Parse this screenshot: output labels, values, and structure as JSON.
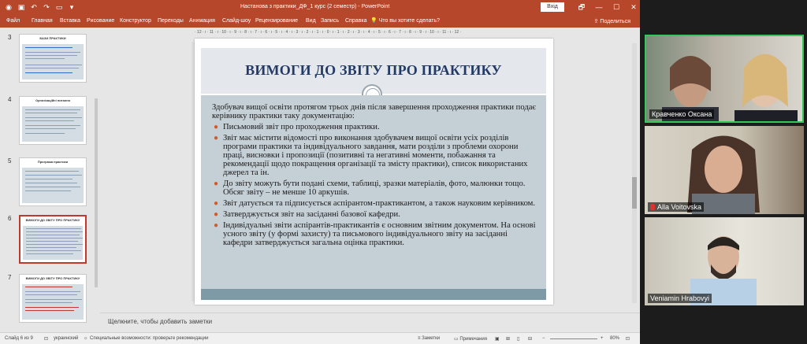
{
  "window": {
    "title": "Настанова з практики_ДФ_1 курс (2 семестр)  -  PowerPoint",
    "signin_label": "Вхід",
    "controls": [
      "🗗",
      "—",
      "☐",
      "✕"
    ]
  },
  "menu": {
    "items": [
      "Файл",
      "Главная",
      "Вставка",
      "Рисование",
      "Конструктор",
      "Переходы",
      "Анимация",
      "Слайд-шоу",
      "Рецензирование",
      "Вид",
      "Запись",
      "Справка"
    ],
    "tell_me": "Что вы хотите сделать?",
    "share": "Поделиться"
  },
  "thumbnails": [
    {
      "number": "3",
      "title": "БАЗИ ПРАКТИКИ"
    },
    {
      "number": "4",
      "title": "Організаційні питання"
    },
    {
      "number": "5",
      "title": "Програма практики"
    },
    {
      "number": "6",
      "title": "ВИМОГИ ДО ЗВІТУ ПРО ПРАКТИКУ"
    },
    {
      "number": "7",
      "title": "ВИМОГИ ДО ЗВІТУ ПРО ПРАКТИКУ"
    }
  ],
  "ruler": {
    "ticks": "· 12 · ı · 11 · ı · 10 · ı · 9 · ı · 8 · ı · 7 · ı · 6 · ı · 5 · ı · 4 · ı · 3 · ı · 2 · ı · 1 · ı · 0 · ı · 1 · ı · 2 · ı · 3 · ı · 4 · ı · 5 · ı · 6 · ı · 7 · ı · 8 · ı · 9 · ı · 10 · ı · 11 · ı · 12 ·"
  },
  "slide": {
    "title": "ВИМОГИ ДО ЗВІТУ ПРО ПРАКТИКУ",
    "intro": "Здобувач вищої освіти протягом трьох днів після завершення проходження практики подає керівнику практики таку документацію:",
    "bullets": [
      "Письмовий звіт про проходження практики.",
      "Звіт має містити відомості про виконання здобувачем вищої освіти усіх розділів програми практики та індивідуального завдання, мати розділи з проблеми охорони праці, висновки і пропозиції (позитивні та негативні моменти, побажання та рекомендації щодо покращення організації та змісту практики), список використаних джерел та ін.",
      "До звіту можуть бути подані схеми, таблиці, зразки матеріалів, фото, малюнки тощо. Обсяг звіту – не менше 10 аркушів.",
      "Звіт датується та підписується аспірантом-практикантом, а також науковим керівником.",
      "Затверджується звіт на засіданні базової кафедри.",
      "Індивідуальні звіти аспірантів-практикантів є основним звітним документом. На основі усного звіту (у формі захисту) та письмового індивідуального звіту на засіданні кафедри затверджується загальна оцінка практики."
    ]
  },
  "notes": {
    "placeholder": "Щелкните, чтобы добавить заметки"
  },
  "status": {
    "slide_counter": "Слайд 6 из 9",
    "language": "украинский",
    "accessibility": "Специальные возможности: проверьте рекомендации",
    "notes_btn": "Заметки",
    "comments_btn": "Примечания",
    "zoom": "80%"
  },
  "participants": [
    {
      "name": "Кравченко Оксана",
      "muted": false,
      "active": true
    },
    {
      "name": "Alla Voitovska",
      "muted": true,
      "active": false
    },
    {
      "name": "Veniamin Hrabovyi",
      "muted": false,
      "active": false
    }
  ],
  "colors": {
    "ppt_accent": "#b7472a",
    "slide_title": "#233a66",
    "bullet": "#d05a28",
    "active_speaker": "#35c759"
  }
}
